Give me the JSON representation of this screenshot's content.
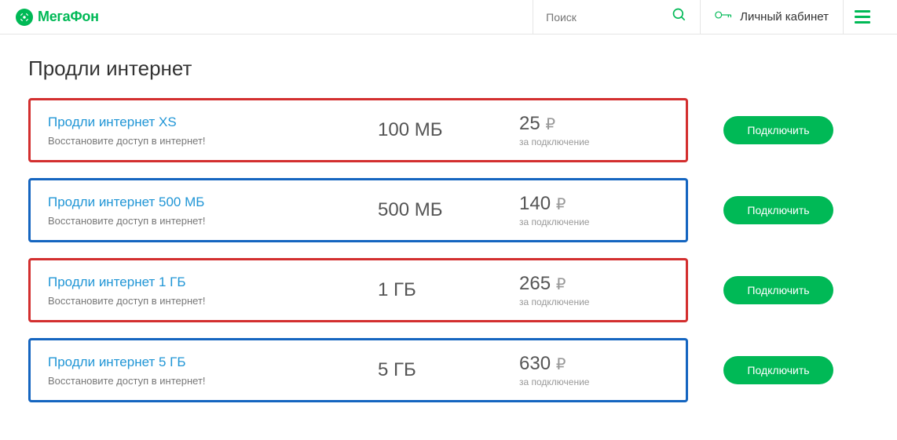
{
  "header": {
    "brand": "МегаФон",
    "search_placeholder": "Поиск",
    "cabinet": "Личный кабинет"
  },
  "page_title": "Продли интернет",
  "plans": [
    {
      "name": "Продли интернет XS",
      "desc": "Восстановите доступ в интернет!",
      "volume": "100 МБ",
      "price": "25",
      "currency": "₽",
      "note": "за подключение",
      "button": "Подключить",
      "variant": "red",
      "has_button": true
    },
    {
      "name": "Продли интернет 500 МБ",
      "desc": "Восстановите доступ в интернет!",
      "volume": "500 МБ",
      "price": "140",
      "currency": "₽",
      "note": "за подключение",
      "button": "Подключить",
      "variant": "blue",
      "has_button": true
    },
    {
      "name": "Продли интернет 1 ГБ",
      "desc": "Восстановите доступ в интернет!",
      "volume": "1 ГБ",
      "price": "265",
      "currency": "₽",
      "note": "за подключение",
      "button": "Подключить",
      "variant": "red",
      "has_button": true
    },
    {
      "name": "Продли интернет 5 ГБ",
      "desc": "Восстановите доступ в интернет!",
      "volume": "5 ГБ",
      "price": "630",
      "currency": "₽",
      "note": "за подключение",
      "button": "Подключить",
      "variant": "blue",
      "has_button": true
    }
  ]
}
